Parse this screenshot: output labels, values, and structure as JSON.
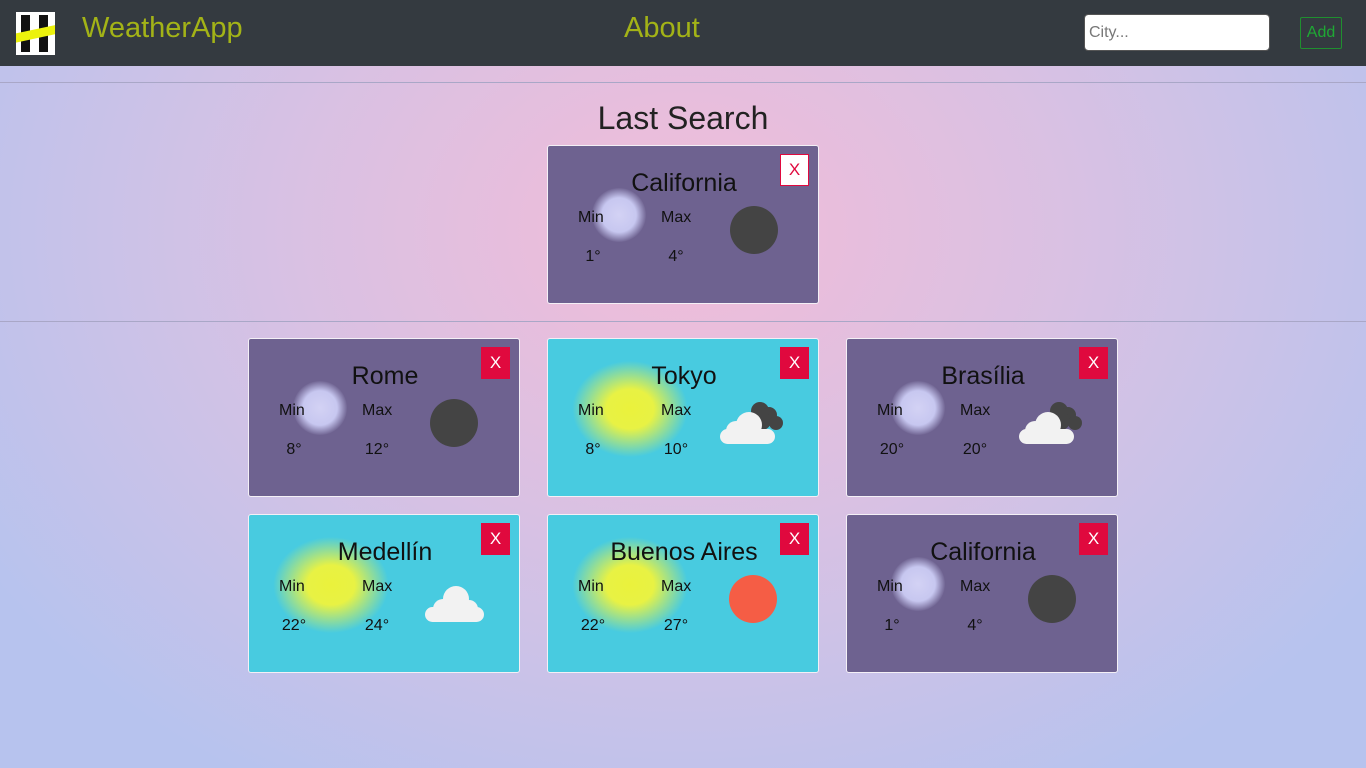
{
  "navbar": {
    "brand": "WeatherApp",
    "about": "About",
    "city_placeholder": "City...",
    "add_label": "Add"
  },
  "last_search": {
    "title": "Last Search",
    "card": {
      "city": "California",
      "min_label": "Min",
      "max_label": "Max",
      "min": "1°",
      "max": "4°",
      "close": "X",
      "theme": "night",
      "icon": "moon-icon"
    }
  },
  "cities": [
    {
      "city": "Rome",
      "min_label": "Min",
      "max_label": "Max",
      "min": "8°",
      "max": "12°",
      "close": "X",
      "theme": "night",
      "icon": "moon-icon"
    },
    {
      "city": "Tokyo",
      "min_label": "Min",
      "max_label": "Max",
      "min": "8°",
      "max": "10°",
      "close": "X",
      "theme": "day",
      "icon": "cloudy-icon"
    },
    {
      "city": "Brasília",
      "min_label": "Min",
      "max_label": "Max",
      "min": "20°",
      "max": "20°",
      "close": "X",
      "theme": "night",
      "icon": "cloudy-icon"
    },
    {
      "city": "Medellín",
      "min_label": "Min",
      "max_label": "Max",
      "min": "22°",
      "max": "24°",
      "close": "X",
      "theme": "day",
      "icon": "cloud-icon"
    },
    {
      "city": "Buenos Aires",
      "min_label": "Min",
      "max_label": "Max",
      "min": "22°",
      "max": "27°",
      "close": "X",
      "theme": "day",
      "icon": "sun-icon"
    },
    {
      "city": "California",
      "min_label": "Min",
      "max_label": "Max",
      "min": "1°",
      "max": "4°",
      "close": "X",
      "theme": "night",
      "icon": "moon-icon"
    }
  ],
  "colors": {
    "navbar": "#343a40",
    "brand": "#a3b317",
    "night_card": "#6e6290",
    "day_card": "#48cbe0",
    "close_button": "#e0093e",
    "sun": "#f55d45",
    "moon": "#444444"
  }
}
